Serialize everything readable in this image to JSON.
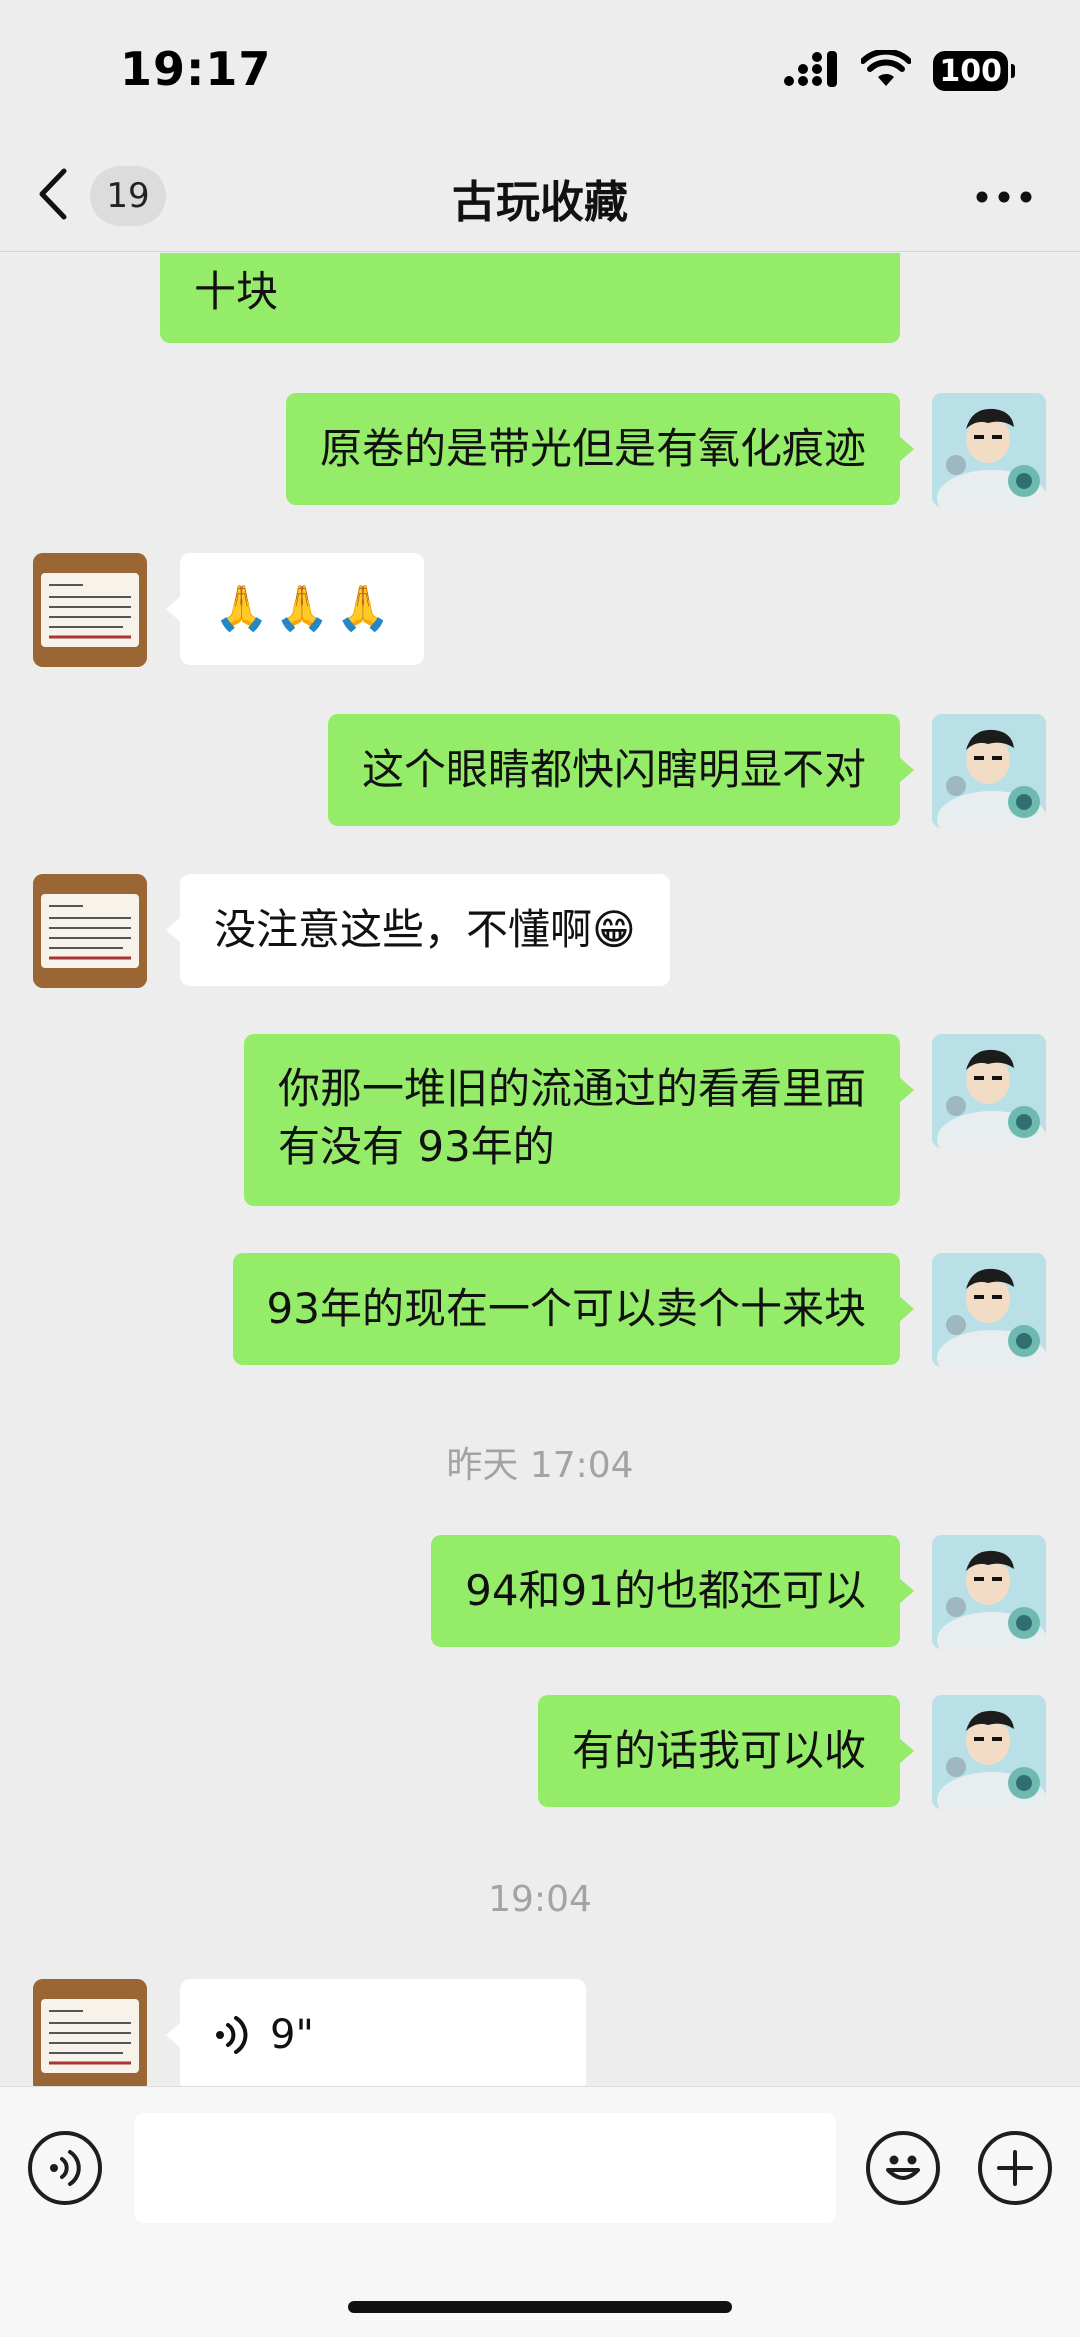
{
  "status_bar": {
    "time": "19:17",
    "battery": "100"
  },
  "header": {
    "unread_count": "19",
    "title": "古玩收藏"
  },
  "messages": [
    {
      "side": "me",
      "text": "十块"
    },
    {
      "side": "me",
      "text": "原卷的是带光但是有氧化痕迹"
    },
    {
      "side": "them",
      "emojis": [
        "🙏",
        "🙏",
        "🙏"
      ]
    },
    {
      "side": "me",
      "text": "这个眼睛都快闪瞎明显不对"
    },
    {
      "side": "them",
      "text": "没注意这些，不懂啊😁"
    },
    {
      "side": "me",
      "lines": [
        "你那一堆旧的流通过的看看里面",
        "有没有 93年的"
      ]
    },
    {
      "side": "me",
      "text": "93年的现在一个可以卖个十来块"
    },
    {
      "timestamp": "昨天 17:04"
    },
    {
      "side": "me",
      "text": "94和91的也都还可以"
    },
    {
      "side": "me",
      "text": "有的话我可以收"
    },
    {
      "timestamp": "19:04"
    },
    {
      "side": "them",
      "voice_duration": "9\""
    }
  ],
  "input_bar": {
    "placeholder": ""
  },
  "colors": {
    "my_bubble": "#95ec69",
    "their_bubble": "#ffffff",
    "background": "#ededed"
  },
  "icons": [
    "back-icon",
    "more-icon",
    "voice-mode-icon",
    "emoji-icon",
    "plus-icon",
    "voice-wave-icon",
    "signal-icon",
    "wifi-icon",
    "battery-icon"
  ]
}
